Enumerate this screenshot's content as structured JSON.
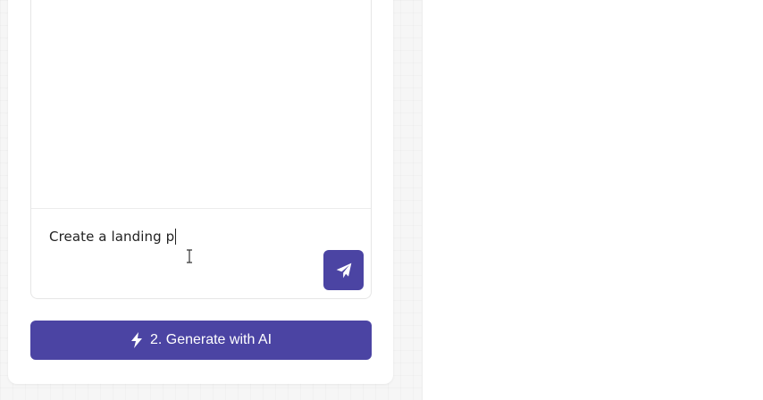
{
  "composer": {
    "prompt_value": "Create a landing p",
    "send_icon": "paper-plane-icon"
  },
  "actions": {
    "generate_label": "2. Generate with AI",
    "generate_icon": "bolt-icon"
  },
  "colors": {
    "accent": "#4b44a3",
    "page_bg": "#f6f6f6",
    "card_bg": "#ffffff",
    "text": "#222222"
  }
}
